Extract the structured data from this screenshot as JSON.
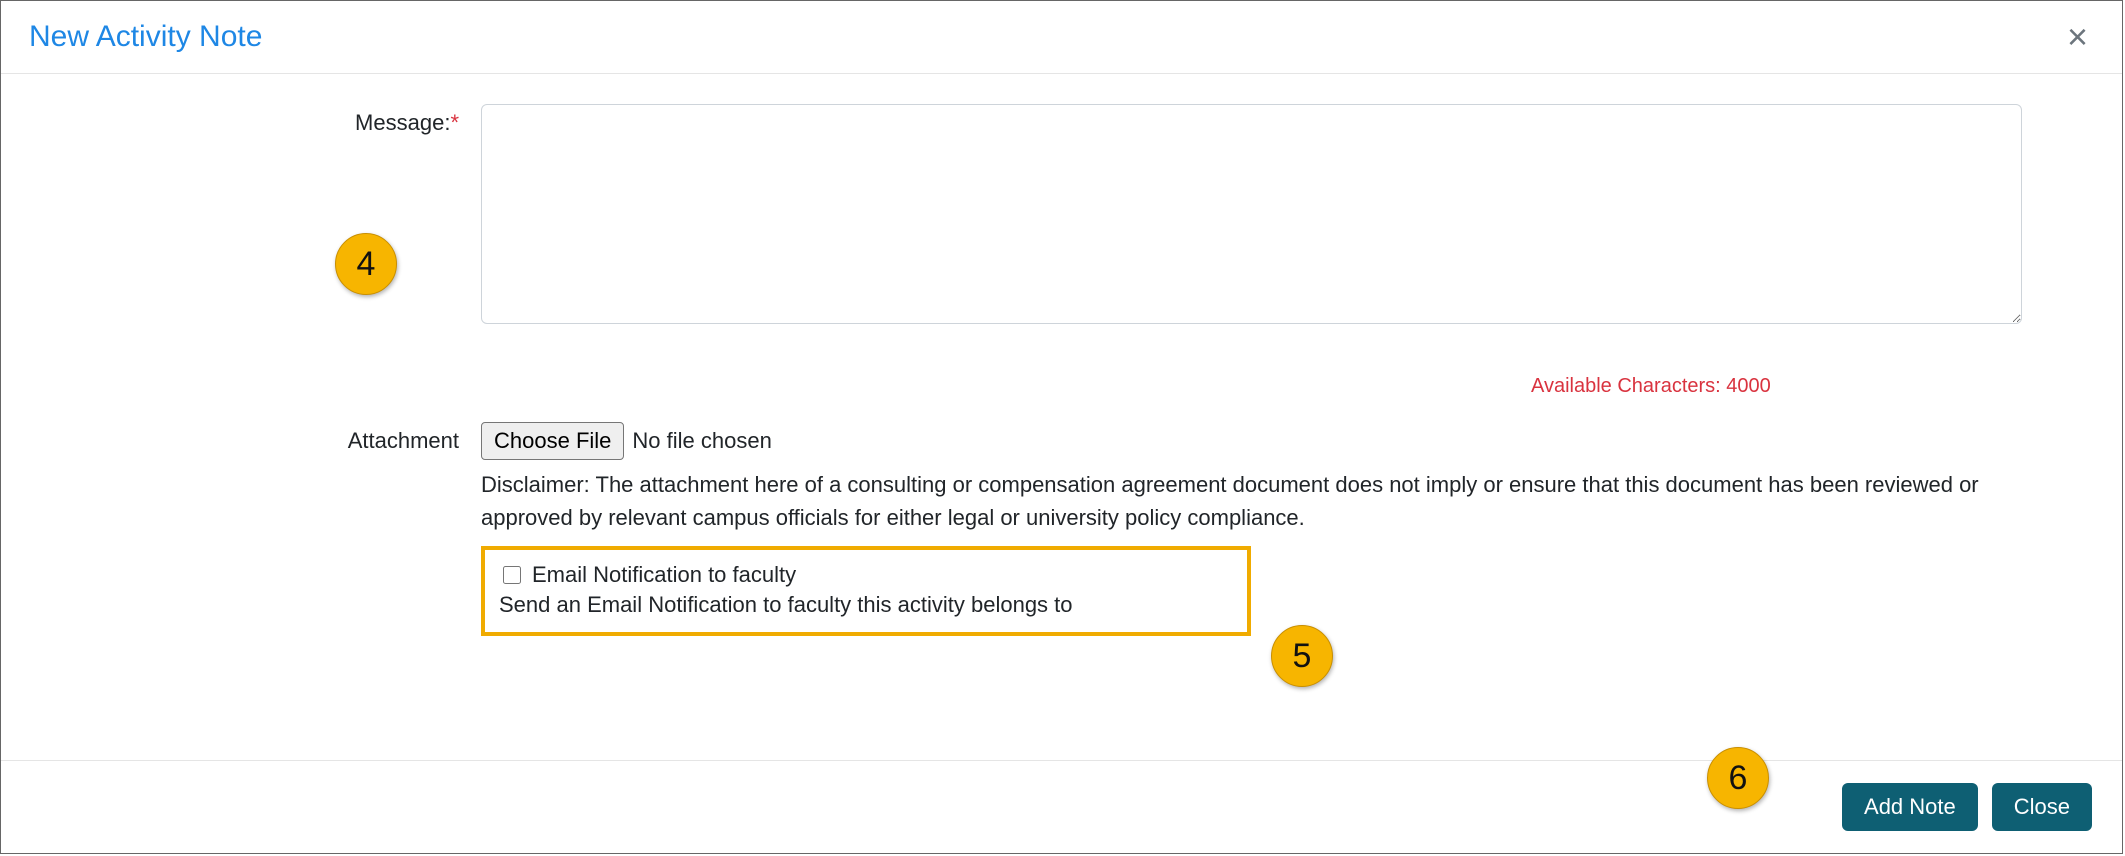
{
  "header": {
    "title": "New Activity Note",
    "close_symbol": "×"
  },
  "message": {
    "label": "Message:",
    "required_mark": "*",
    "value": "",
    "available_chars_text": "Available Characters: 4000"
  },
  "attachment": {
    "label": "Attachment",
    "choose_button": "Choose File",
    "no_file_text": "No file chosen",
    "disclaimer": "Disclaimer: The attachment here of a consulting or compensation agreement document does not imply or ensure that this document has been reviewed or approved by relevant campus officials for either legal or university policy compliance."
  },
  "email": {
    "checkbox_label": "Email Notification to faculty",
    "description": "Send an Email Notification to faculty this activity belongs to"
  },
  "footer": {
    "add_note": "Add Note",
    "close": "Close"
  },
  "callouts": {
    "c4": "4",
    "c5": "5",
    "c6": "6"
  }
}
